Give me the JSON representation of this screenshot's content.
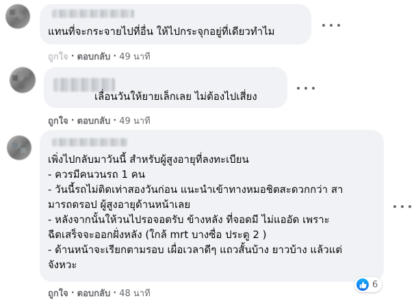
{
  "comments": [
    {
      "text_lines": [
        "แทนที่จะกระจายไปที่อื่น ให้ไปกระจุกอยู่ที่เดียวทำไม"
      ],
      "actions": {
        "like": "ถูกใจ",
        "reply": "ตอบกลับ",
        "time": "49 นาที"
      }
    },
    {
      "text_lines": [
        "เลื่อนวันให้ยายเล็กเลย ไม่ต้องไปเสี่ยง"
      ],
      "actions": {
        "like": "ถูกใจ",
        "reply": "ตอบกลับ",
        "time": "49 นาที"
      }
    },
    {
      "text_lines": [
        "เพิ่งไปกลับมาวันนี้ สำหรับผู้สูงอายุที่ลงทะเบียน",
        "- ควรมีคนวนรถ 1 คน",
        "- วันนี้รถไม่ติดเท่าสองวันก่อน แนะนำเข้าทางหมอชิตสะดวกกว่า สา",
        "มารถดรอป ผู้สูงอายุด้านหน้าเลย",
        "- หลังจากนั้นให้วนไปรอจอดรับ ข้างหลัง ที่จอดมี ไม่แออัด เพราะ",
        "ฉีดเสร็จจะออกฝั่งหลัง (ใกล้ mrt บางซื่อ ประตู 2 )",
        "- ด้านหน้าจะเรียกตามรอบ เผื่อเวลาดีๆ แถวสั้นบ้าง ยาวบ้าง แล้วแต่",
        "จังหวะ"
      ],
      "reaction_count": "6",
      "actions": {
        "like": "ถูกใจ",
        "reply": "ตอบกลับ",
        "time": "48 นาที"
      }
    }
  ],
  "separator": "·",
  "colors": {
    "bubble": "#f0f2f5",
    "meta": "#65676b",
    "text": "#050505",
    "like_blue": "#1877f2"
  }
}
